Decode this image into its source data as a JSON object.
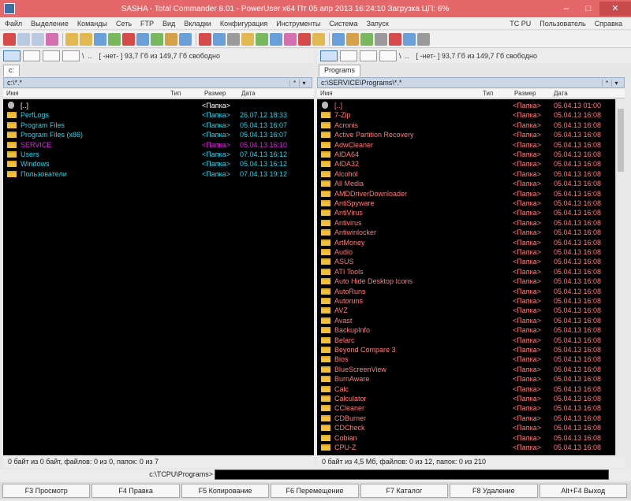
{
  "window": {
    "title": "SASHA - Total Commander 8.01 - PowerUser x64   Пт 05 апр 2013   16:24:10   Загрузка ЦП: 6%"
  },
  "menu": {
    "items": [
      "Файл",
      "Выделение",
      "Команды",
      "Сеть",
      "FTP",
      "Вид",
      "Вкладки",
      "Конфигурация",
      "Инструменты",
      "Система",
      "Запуск"
    ],
    "right_items": [
      "TC PU",
      "Пользователь",
      "Справка"
    ]
  },
  "left": {
    "drive_info": "[ -нет- ]  93,7 Гб из 149,7 Гб свободно",
    "tab": "c:",
    "path": "c:\\*.*",
    "columns": {
      "name": "Имя",
      "ext": "Тип",
      "size": "Размер",
      "date": "Дата"
    },
    "rows": [
      {
        "name": "[..]",
        "ext": "",
        "size": "<Папка>",
        "date": "",
        "color": "#ffffff",
        "up": true
      },
      {
        "name": "PerfLogs",
        "ext": "",
        "size": "<Папка>",
        "date": "26.07.12 18:33",
        "color": "#22d3e8"
      },
      {
        "name": "Program Files",
        "ext": "",
        "size": "<Папка>",
        "date": "05.04.13 16:07",
        "color": "#22d3e8"
      },
      {
        "name": "Program Files (x86)",
        "ext": "",
        "size": "<Папка>",
        "date": "05.04.13 16:07",
        "color": "#22d3e8"
      },
      {
        "name": "SERVICE",
        "ext": "",
        "size": "<Папка>",
        "date": "05.04.13 16:10",
        "color": "#e51ee5"
      },
      {
        "name": "Users",
        "ext": "",
        "size": "<Папка>",
        "date": "07.04.13 16:12",
        "color": "#22d3e8"
      },
      {
        "name": "Windows",
        "ext": "",
        "size": "<Папка>",
        "date": "05.04.13 16:12",
        "color": "#22d3e8"
      },
      {
        "name": "Пользователи",
        "ext": "",
        "size": "<Папка>",
        "date": "07.04.13 19:12",
        "color": "#22d3e8"
      }
    ],
    "status": "0 байт из 0 байт, файлов: 0 из 0, папок: 0 из 7"
  },
  "right": {
    "drive_info": "[ -нет- ]  93,7 Гб из 149,7 Гб свободно",
    "tab": "Programs",
    "path": "c:\\SERVICE\\Programs\\*.*",
    "columns": {
      "name": "Имя",
      "ext": "Тип",
      "size": "Размер",
      "date": "Дата"
    },
    "row_color": "#ff7a7a",
    "rows": [
      {
        "name": "[..]",
        "size": "<Папка>",
        "date": "05.04.13 01:00",
        "up": true
      },
      {
        "name": "7-Zip",
        "size": "<Папка>",
        "date": "05.04.13 16:08"
      },
      {
        "name": "Acronis",
        "size": "<Папка>",
        "date": "05.04.13 16:08"
      },
      {
        "name": "Active Partition Recovery",
        "size": "<Папка>",
        "date": "05.04.13 16:08"
      },
      {
        "name": "AdwCleaner",
        "size": "<Папка>",
        "date": "05.04.13 16:08"
      },
      {
        "name": "AIDA64",
        "size": "<Папка>",
        "date": "05.04.13 16:08"
      },
      {
        "name": "AIDA32",
        "size": "<Папка>",
        "date": "05.04.13 16:08"
      },
      {
        "name": "Alcohol",
        "size": "<Папка>",
        "date": "05.04.13 16:08"
      },
      {
        "name": "All Media",
        "size": "<Папка>",
        "date": "05.04.13 16:08"
      },
      {
        "name": "AMDDriverDownloader",
        "size": "<Папка>",
        "date": "05.04.13 16:08"
      },
      {
        "name": "AntiSpyware",
        "size": "<Папка>",
        "date": "05.04.13 16:08"
      },
      {
        "name": "AntiVirus",
        "size": "<Папка>",
        "date": "05.04.13 16:08"
      },
      {
        "name": "Antivirus",
        "size": "<Папка>",
        "date": "05.04.13 16:08"
      },
      {
        "name": "Antiwinlocker",
        "size": "<Папка>",
        "date": "05.04.13 16:08"
      },
      {
        "name": "ArtMoney",
        "size": "<Папка>",
        "date": "05.04.13 16:08"
      },
      {
        "name": "Audio",
        "size": "<Папка>",
        "date": "05.04.13 16:08"
      },
      {
        "name": "ASUS",
        "size": "<Папка>",
        "date": "05.04.13 16:08"
      },
      {
        "name": "ATI Tools",
        "size": "<Папка>",
        "date": "05.04.13 16:08"
      },
      {
        "name": "Auto Hide Desktop Icons",
        "size": "<Папка>",
        "date": "05.04.13 16:08"
      },
      {
        "name": "AutoRuns",
        "size": "<Папка>",
        "date": "05.04.13 16:08"
      },
      {
        "name": "Autoruns",
        "size": "<Папка>",
        "date": "05.04.13 16:08"
      },
      {
        "name": "AVZ",
        "size": "<Папка>",
        "date": "05.04.13 16:08"
      },
      {
        "name": "Avast",
        "size": "<Папка>",
        "date": "05.04.13 16:08"
      },
      {
        "name": "BackupInfo",
        "size": "<Папка>",
        "date": "05.04.13 16:08"
      },
      {
        "name": "Belarc",
        "size": "<Папка>",
        "date": "05.04.13 16:08"
      },
      {
        "name": "Beyond Compare 3",
        "size": "<Папка>",
        "date": "05.04.13 16:08"
      },
      {
        "name": "Bios",
        "size": "<Папка>",
        "date": "05.04.13 16:08"
      },
      {
        "name": "BlueScreenView",
        "size": "<Папка>",
        "date": "05.04.13 16:08"
      },
      {
        "name": "BurnAware",
        "size": "<Папка>",
        "date": "05.04.13 16:08"
      },
      {
        "name": "Calc",
        "size": "<Папка>",
        "date": "05.04.13 16:08"
      },
      {
        "name": "Calculator",
        "size": "<Папка>",
        "date": "05.04.13 16:08"
      },
      {
        "name": "CCleaner",
        "size": "<Папка>",
        "date": "05.04.13 16:08"
      },
      {
        "name": "CDBurner",
        "size": "<Папка>",
        "date": "05.04.13 16:08"
      },
      {
        "name": "CDCheck",
        "size": "<Папка>",
        "date": "05.04.13 16:08"
      },
      {
        "name": "Cobian",
        "size": "<Папка>",
        "date": "05.04.13 16:08"
      },
      {
        "name": "CPU-Z",
        "size": "<Папка>",
        "date": "05.04.13 16:08"
      }
    ],
    "status": "0 байт из 4,5 Мб, файлов: 0 из 12, папок: 0 из 210"
  },
  "command_line": {
    "path": "c:\\TCPU\\Programs>"
  },
  "fkeys": [
    "F3 Просмотр",
    "F4 Правка",
    "F5 Копирование",
    "F6 Перемещение",
    "F7 Каталог",
    "F8 Удаление",
    "Alt+F4 Выход"
  ],
  "colors": {
    "titlebar": "#e4686a",
    "panel_bg": "#000000",
    "folder_left": "#22d3e8",
    "folder_right": "#ff7a7a",
    "highlight": "#e51ee5"
  }
}
